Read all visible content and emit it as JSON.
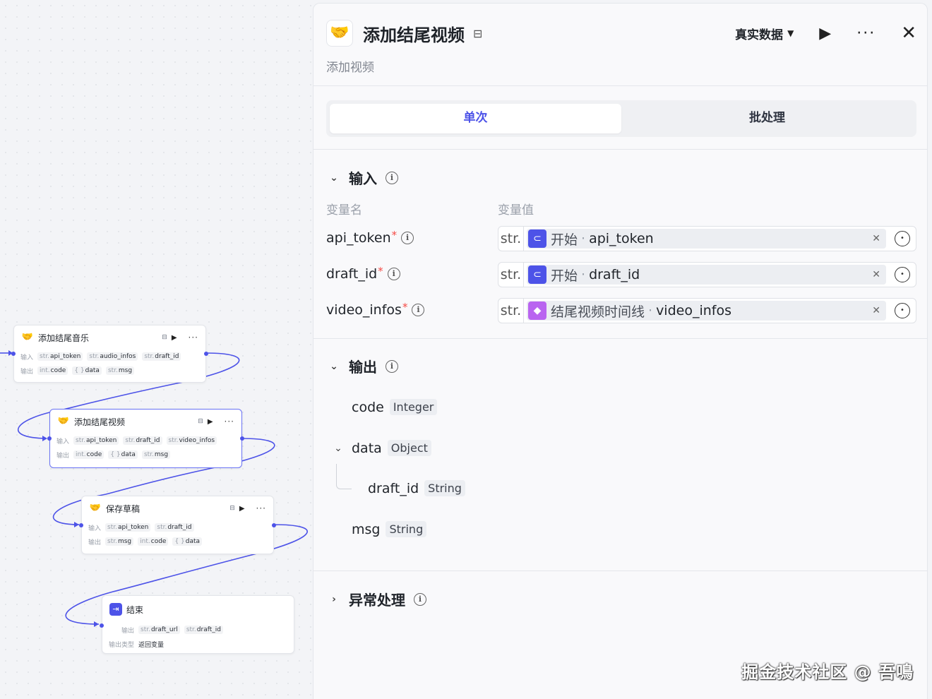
{
  "canvas": {
    "nodes": [
      {
        "title": "添加结尾音乐",
        "input_label": "输入",
        "inputs": [
          {
            "type": "str.",
            "name": "api_token"
          },
          {
            "type": "str.",
            "name": "audio_infos"
          },
          {
            "type": "str.",
            "name": "draft_id"
          }
        ],
        "output_label": "输出",
        "outputs": [
          {
            "type": "int.",
            "name": "code"
          },
          {
            "type": "{ }",
            "name": "data"
          },
          {
            "type": "str.",
            "name": "msg"
          }
        ]
      },
      {
        "title": "添加结尾视频",
        "input_label": "输入",
        "inputs": [
          {
            "type": "str.",
            "name": "api_token"
          },
          {
            "type": "str.",
            "name": "draft_id"
          },
          {
            "type": "str.",
            "name": "video_infos"
          }
        ],
        "output_label": "输出",
        "outputs": [
          {
            "type": "int.",
            "name": "code"
          },
          {
            "type": "{ }",
            "name": "data"
          },
          {
            "type": "str.",
            "name": "msg"
          }
        ]
      },
      {
        "title": "保存草稿",
        "input_label": "输入",
        "inputs": [
          {
            "type": "str.",
            "name": "api_token"
          },
          {
            "type": "str.",
            "name": "draft_id"
          }
        ],
        "output_label": "输出",
        "outputs": [
          {
            "type": "str.",
            "name": "msg"
          },
          {
            "type": "int.",
            "name": "code"
          },
          {
            "type": "{ }",
            "name": "data"
          }
        ]
      }
    ],
    "end_node": {
      "title": "结束",
      "output_label": "输出",
      "outputs": [
        {
          "type": "str.",
          "name": "draft_url"
        },
        {
          "type": "str.",
          "name": "draft_id"
        }
      ],
      "output_type_label": "输出类型",
      "output_type_value": "返回变量"
    }
  },
  "panel": {
    "title": "添加结尾视频",
    "subtitle": "添加视频",
    "data_mode": "真实数据",
    "tabs": [
      "单次",
      "批处理"
    ],
    "active_tab": 0,
    "input_section": {
      "title": "输入",
      "col_name": "变量名",
      "col_value": "变量值",
      "rows": [
        {
          "name": "api_token",
          "required": "*",
          "type": "str.",
          "source_node": "开始",
          "source_var": "api_token",
          "icon": "start-icon"
        },
        {
          "name": "draft_id",
          "required": "*",
          "type": "str.",
          "source_node": "开始",
          "source_var": "draft_id",
          "icon": "start-icon"
        },
        {
          "name": "video_infos",
          "required": "*",
          "type": "str.",
          "source_node": "结尾视频时间线",
          "source_var": "video_infos",
          "icon": "cube-icon"
        }
      ]
    },
    "output_section": {
      "title": "输出",
      "fields": [
        {
          "name": "code",
          "type": "Integer"
        },
        {
          "name": "data",
          "type": "Object"
        },
        {
          "name": "draft_id",
          "type": "String"
        },
        {
          "name": "msg",
          "type": "String"
        }
      ]
    },
    "error_section": {
      "title": "异常处理"
    },
    "colors": {
      "accent": "#4d53e8",
      "required": "#f54a45",
      "video_icon": "#b964f0"
    }
  },
  "watermark": "掘金技术社区 @ 吾鳴"
}
